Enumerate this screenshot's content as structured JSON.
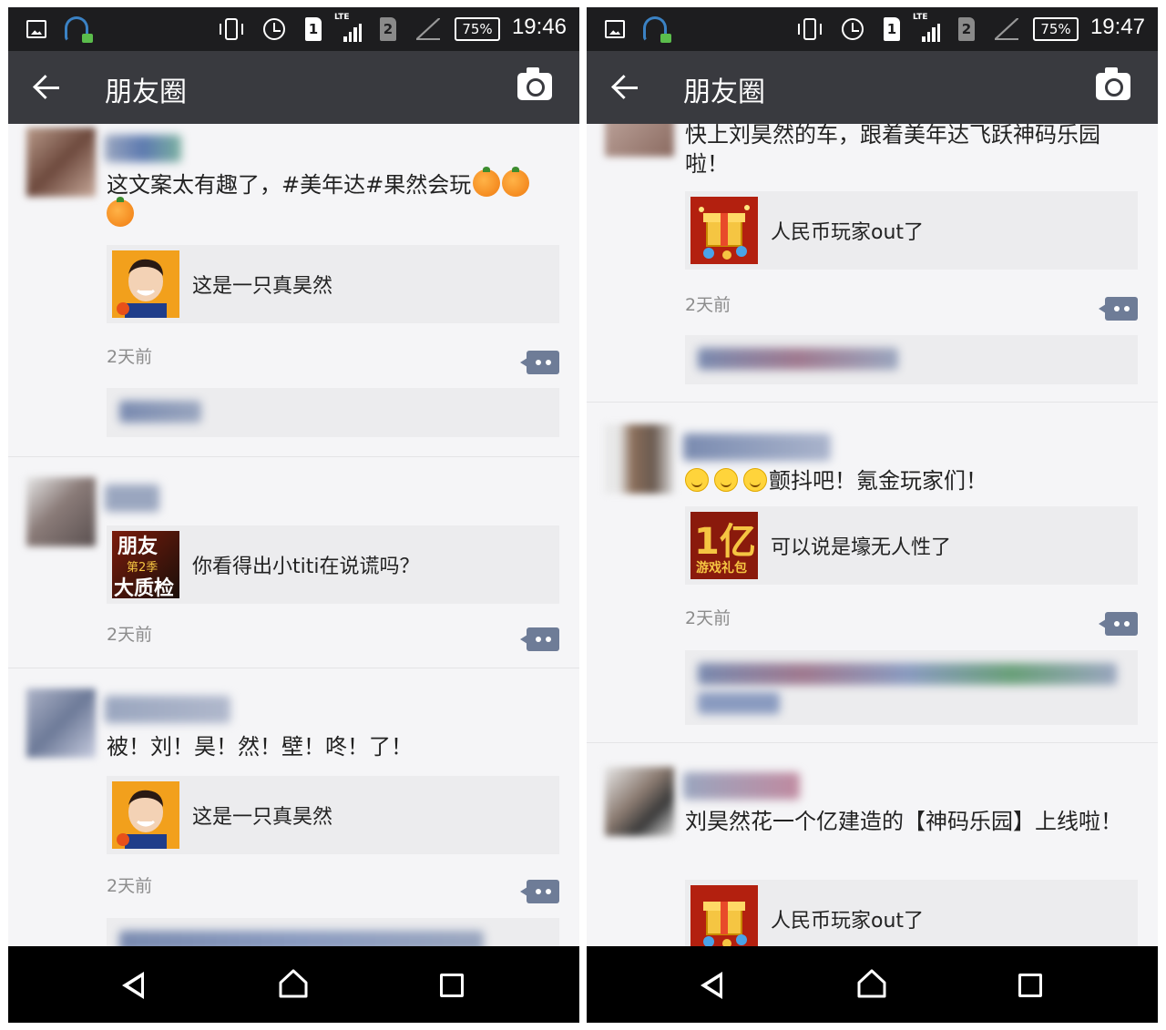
{
  "screens": {
    "left": {
      "status": {
        "battery": "75%",
        "time": "19:46",
        "sim1": "1",
        "sim2": "2",
        "network": "LTE"
      },
      "header": {
        "title": "朋友圈"
      },
      "posts": [
        {
          "text": "这文案太有趣了，#美年达#果然会玩",
          "link": "这是一只真昊然",
          "time": "2天前"
        },
        {
          "text": "",
          "link": "你看得出小titi在说谎吗？",
          "time": "2天前",
          "thumb_text_1": "朋友",
          "thumb_text_2": "第2季",
          "thumb_text_3": "大质检"
        },
        {
          "text": "被！刘！昊！然！壁！咚！了！",
          "link": "这是一只真昊然",
          "time": "2天前"
        }
      ]
    },
    "right": {
      "status": {
        "battery": "75%",
        "time": "19:47",
        "sim1": "1",
        "sim2": "2",
        "network": "LTE"
      },
      "header": {
        "title": "朋友圈"
      },
      "posts": [
        {
          "text": "快上刘昊然的车，跟着美年达飞跃神码乐园啦！",
          "link": "人民币玩家out了",
          "time": "2天前"
        },
        {
          "text": "颤抖吧！氪金玩家们！",
          "link": "可以说是壕无人性了",
          "time": "2天前",
          "thumb_text_1": "1亿",
          "thumb_text_2": "游戏礼包"
        },
        {
          "text": "刘昊然花一个亿建造的【神码乐园】上线啦！",
          "link": "人民币玩家out了",
          "time": ""
        }
      ]
    }
  },
  "icons": [
    "back-arrow-icon",
    "camera-icon",
    "comment-icon",
    "nav-back-icon",
    "nav-home-icon",
    "nav-recents-icon"
  ],
  "colors": {
    "app_bar": "#393a3f",
    "status_bar": "#1d1d1f",
    "comment_button": "#6e7c97",
    "background": "#f5f5f7"
  }
}
